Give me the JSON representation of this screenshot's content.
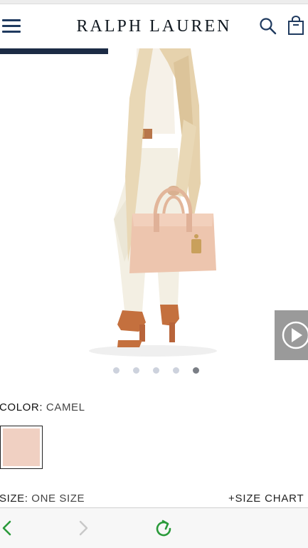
{
  "header": {
    "brand": "RALPH LAUREN",
    "menu_icon": "hamburger-menu-icon",
    "search_icon": "search-icon",
    "bag_icon": "shopping-bag-icon"
  },
  "carousel": {
    "progress_fraction": 0.35,
    "dot_count": 5,
    "active_dot_index": 4,
    "video_icon": "play-icon"
  },
  "product": {
    "color_label": "COLOR:",
    "color_value": "CAMEL",
    "swatch_color": "#f0d0c2",
    "size_label": "SIZE:",
    "size_value": "ONE SIZE",
    "size_chart_link": "+SIZE CHART"
  },
  "colors": {
    "brand_navy": "#1c2b45",
    "icon_blue": "#1f3a5f",
    "toolbar_green": "#2a9a3a"
  },
  "toolbar": {
    "back_icon": "chevron-left-icon",
    "forward_icon": "chevron-right-icon",
    "reload_icon": "reload-icon"
  }
}
